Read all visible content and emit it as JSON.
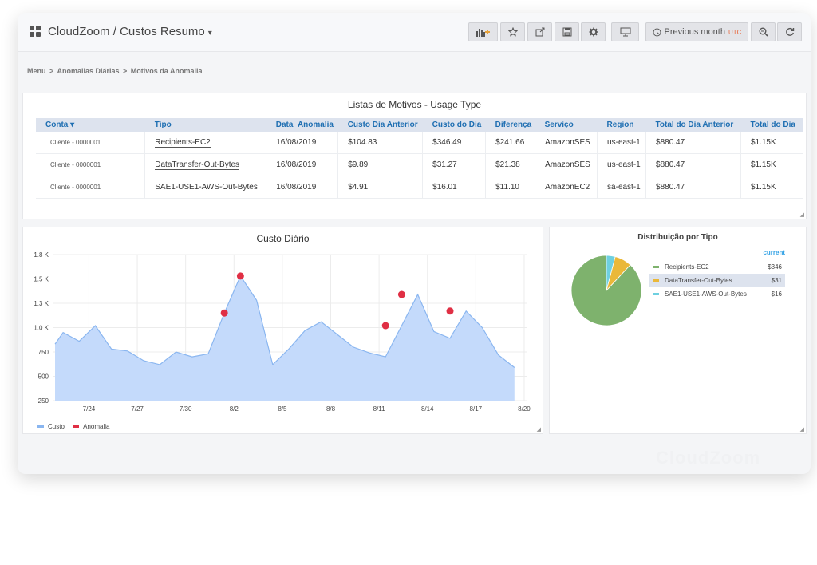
{
  "header": {
    "title": "CloudZoom / Custos Resumo",
    "time_range": "Previous month",
    "timezone": "UTC"
  },
  "breadcrumb": [
    "Menu",
    ">",
    "Anomalias Diárias",
    ">",
    "Motivos da Anomalia"
  ],
  "table": {
    "title": "Listas de Motivos - Usage Type",
    "columns": [
      "Conta ▾",
      "Tipo",
      "Data_Anomalia",
      "Custo Dia Anterior",
      "Custo do Dia",
      "Diferença",
      "Serviço",
      "Region",
      "Total do Dia Anterior",
      "Total do Dia"
    ],
    "rows": [
      [
        "Cliente - 0000001",
        "Recipients-EC2",
        "16/08/2019",
        "$104.83",
        "$346.49",
        "$241.66",
        "AmazonSES",
        "us-east-1",
        "$880.47",
        "$1.15K"
      ],
      [
        "Cliente - 0000001",
        "DataTransfer-Out-Bytes",
        "16/08/2019",
        "$9.89",
        "$31.27",
        "$21.38",
        "AmazonSES",
        "us-east-1",
        "$880.47",
        "$1.15K"
      ],
      [
        "Cliente - 0000001",
        "SAE1-USE1-AWS-Out-Bytes",
        "16/08/2019",
        "$4.91",
        "$16.01",
        "$11.10",
        "AmazonEC2",
        "sa-east-1",
        "$880.47",
        "$1.15K"
      ]
    ]
  },
  "chart_data": [
    {
      "type": "area",
      "title": "Custo Diário",
      "y_ticks": [
        "1.8 K",
        "1.5 K",
        "1.3 K",
        "1.0 K",
        "750",
        "500",
        "250"
      ],
      "x_ticks": [
        "7/24",
        "7/27",
        "7/30",
        "8/2",
        "8/5",
        "8/8",
        "8/11",
        "8/14",
        "8/17",
        "8/20"
      ],
      "ylim": [
        250,
        1750
      ],
      "x_range": [
        21.8,
        51.2
      ],
      "grid": true,
      "legend_position": "bottom-left",
      "series": [
        {
          "name": "Custo",
          "color": "#8ab6f0",
          "x": [
            21.9,
            22.4,
            23.4,
            24.4,
            25.4,
            26.4,
            27.4,
            28.4,
            29.4,
            30.4,
            31.4,
            32.4,
            33.4,
            34.4,
            35.4,
            36.4,
            37.4,
            38.4,
            39.4,
            40.4,
            41.4,
            42.4,
            43.4,
            44.4,
            45.4,
            46.4,
            47.4,
            48.4,
            49.4,
            50.4
          ],
          "values": [
            830,
            950,
            860,
            1020,
            780,
            760,
            660,
            620,
            750,
            700,
            730,
            1150,
            1530,
            1280,
            620,
            780,
            970,
            1060,
            930,
            800,
            740,
            700,
            1020,
            1340,
            960,
            890,
            1170,
            1000,
            720,
            590
          ]
        },
        {
          "name": "Anomalia",
          "color": "#e02f44",
          "x": [
            32.4,
            33.4,
            42.4,
            43.4,
            46.4
          ],
          "values": [
            1150,
            1530,
            1020,
            1340,
            1170
          ]
        }
      ]
    },
    {
      "type": "pie",
      "title": "Distribuição por Tipo",
      "legend_header": "current",
      "slices": [
        {
          "label": "Recipients-EC2",
          "value": 346,
          "display": "$346",
          "color": "#7eb26d"
        },
        {
          "label": "DataTransfer-Out-Bytes",
          "value": 31,
          "display": "$31",
          "color": "#eab839"
        },
        {
          "label": "SAE1-USE1-AWS-Out-Bytes",
          "value": 16,
          "display": "$16",
          "color": "#6ed0e0"
        }
      ]
    }
  ],
  "watermark": "CloudZoom"
}
